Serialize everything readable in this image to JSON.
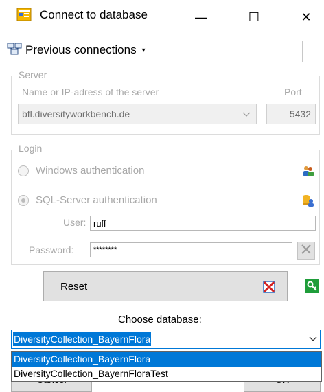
{
  "window": {
    "title": "Connect to database",
    "minimize": "—",
    "maximize": "☐",
    "close": "✕"
  },
  "toolbar": {
    "previous_connections": "Previous connections",
    "caret": "▾"
  },
  "server": {
    "legend": "Server",
    "name_label": "Name or IP-adress of the server",
    "port_label": "Port",
    "name_value": "bfl.diversityworkbench.de",
    "port_value": "5432"
  },
  "login": {
    "legend": "Login",
    "windows_auth": "Windows authentication",
    "sql_auth": "SQL-Server authentication",
    "selected_auth": "SQL-Server authentication",
    "user_label": "User:",
    "user_value": "ruff",
    "password_label": "Password:",
    "password_value": "********"
  },
  "actions": {
    "reset": "Reset",
    "cancel": "Cancel",
    "ok": "OK"
  },
  "database": {
    "label": "Choose database:",
    "selected": "DiversityCollection_BayernFlora",
    "options": [
      "DiversityCollection_BayernFlora",
      "DiversityCollection_BayernFloraTest"
    ]
  },
  "icons": {
    "app": "database-connect-icon",
    "connections": "network-icon",
    "windows_auth": "users-icon",
    "sql_auth": "database-user-icon",
    "clear_password": "clear-icon",
    "reset_delete": "delete-icon",
    "connect_key": "key-icon"
  },
  "colors": {
    "accent": "#0078d7",
    "disabled_text": "#a8a8a8",
    "button_face": "#e1e1e1"
  }
}
